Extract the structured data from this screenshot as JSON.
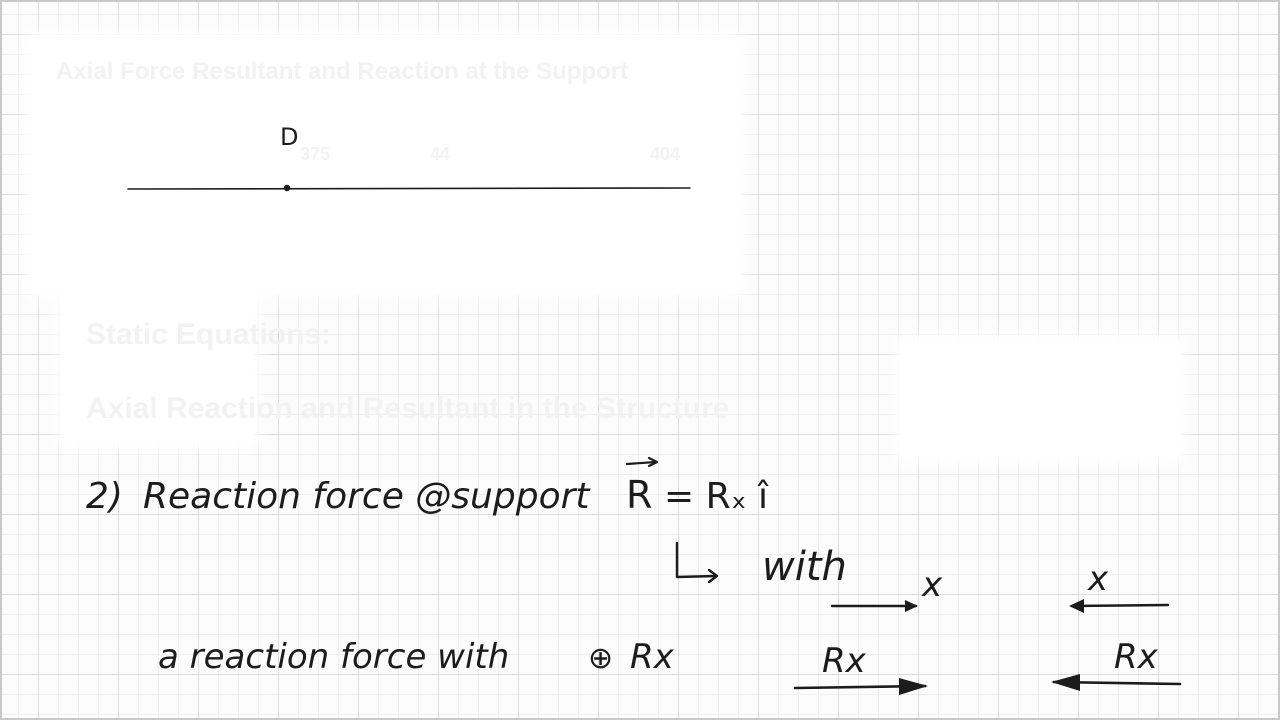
{
  "faded_header": {
    "title": "Axial Force Resultant and Reaction at the Support",
    "dim_labels": [
      "375",
      "44",
      "404"
    ]
  },
  "faded_notes": {
    "line1": "Static Equations:",
    "line2": "Axial Reaction and Resultant in the Structure"
  },
  "beam": {
    "point_label": "D"
  },
  "notes": {
    "item_number": "2)",
    "heading": "Reaction force @support",
    "vector_symbol": "R",
    "equation_rhs": "= Rₓ î",
    "with_label": "with",
    "reaction_text": "a reaction force with",
    "plus_symbol": "⊕",
    "reaction_var": "Rx"
  },
  "axes": {
    "left": {
      "axis_label": "x",
      "force_label": "Rx",
      "direction": "right"
    },
    "right": {
      "axis_label": "x",
      "force_label": "Rx",
      "direction": "left"
    }
  }
}
